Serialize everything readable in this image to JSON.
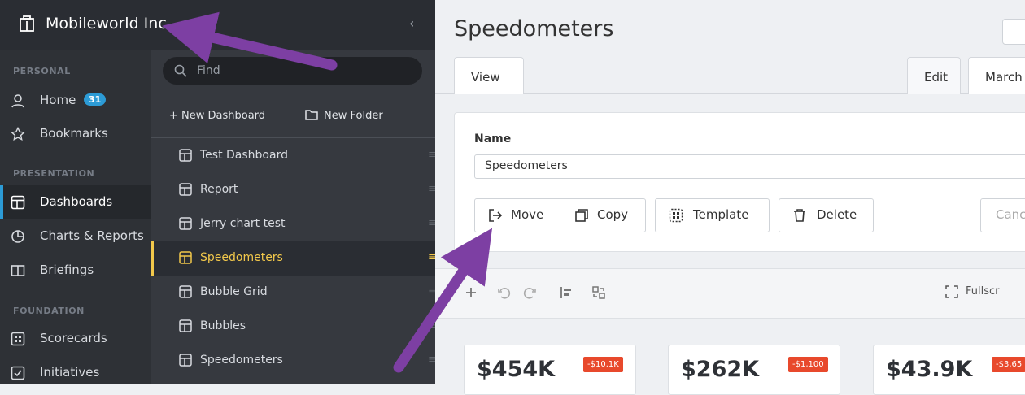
{
  "org": {
    "name": "Mobileworld Inc.",
    "collapse": "‹"
  },
  "sidebar": {
    "sections": {
      "personal": "PERSONAL",
      "presentation": "PRESENTATION",
      "foundation": "FOUNDATION"
    },
    "home": {
      "label": "Home",
      "badge": "31"
    },
    "bookmarks": {
      "label": "Bookmarks"
    },
    "dashboards": {
      "label": "Dashboards"
    },
    "charts": {
      "label": "Charts & Reports"
    },
    "briefings": {
      "label": "Briefings"
    },
    "scorecards": {
      "label": "Scorecards"
    },
    "initiatives": {
      "label": "Initiatives"
    }
  },
  "list": {
    "search_placeholder": "Find",
    "new_dashboard": "+  New Dashboard",
    "new_folder": "New Folder",
    "items": [
      "Test Dashboard",
      "Report",
      "Jerry chart test",
      "Speedometers",
      "Bubble Grid",
      "Bubbles",
      "Speedometers"
    ]
  },
  "main": {
    "title": "Speedometers",
    "tabs": {
      "view": "View",
      "edit": "Edit",
      "march": "March"
    },
    "name_label": "Name",
    "name_value": "Speedometers",
    "buttons": {
      "move": "Move",
      "copy": "Copy",
      "template": "Template",
      "delete": "Delete",
      "cancel": "Canc"
    },
    "fullscreen": "Fullscr",
    "kpis": [
      {
        "value": "$454K",
        "delta": "-$10.1K"
      },
      {
        "value": "$262K",
        "delta": "-$1,100"
      },
      {
        "value": "$43.9K",
        "delta": "-$3,65"
      }
    ]
  },
  "colors": {
    "accent": "#2c9bd6",
    "active": "#f2c84b",
    "arrow": "#7d3fa3",
    "negative": "#e8492c"
  }
}
